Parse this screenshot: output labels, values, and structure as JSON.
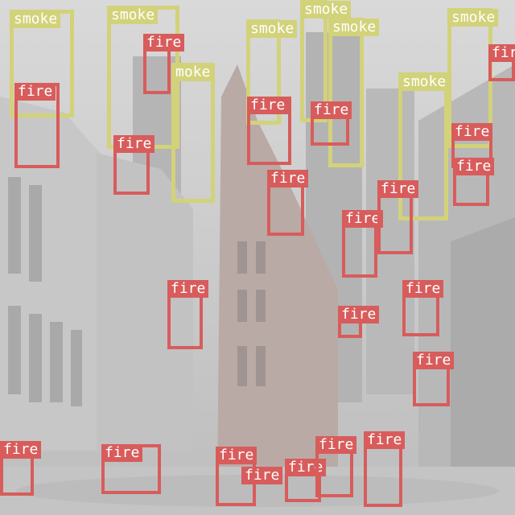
{
  "scene": {
    "description_label": "",
    "palette": {
      "smoke": "#d2d27a",
      "fire": "#d85c5c"
    }
  },
  "detections": [
    {
      "label": "smoke"
    },
    {
      "label": "smoke"
    },
    {
      "label": "moke"
    },
    {
      "label": "smoke"
    },
    {
      "label": "smoke"
    },
    {
      "label": "smoke"
    },
    {
      "label": "smoke"
    },
    {
      "label": "smoke"
    },
    {
      "label": "fire"
    },
    {
      "label": "fire"
    },
    {
      "label": "fire"
    },
    {
      "label": "fire"
    },
    {
      "label": "fire"
    },
    {
      "label": "fire"
    },
    {
      "label": "fire"
    },
    {
      "label": "fire"
    },
    {
      "label": "fire"
    },
    {
      "label": "fire"
    },
    {
      "label": "fire"
    },
    {
      "label": "fire"
    },
    {
      "label": "fire"
    },
    {
      "label": "fire"
    },
    {
      "label": "fire"
    },
    {
      "label": "fire"
    },
    {
      "label": "fire"
    },
    {
      "label": "fire"
    },
    {
      "label": "fire"
    },
    {
      "label": "fire"
    },
    {
      "label": "fire"
    },
    {
      "label": "fire"
    }
  ]
}
